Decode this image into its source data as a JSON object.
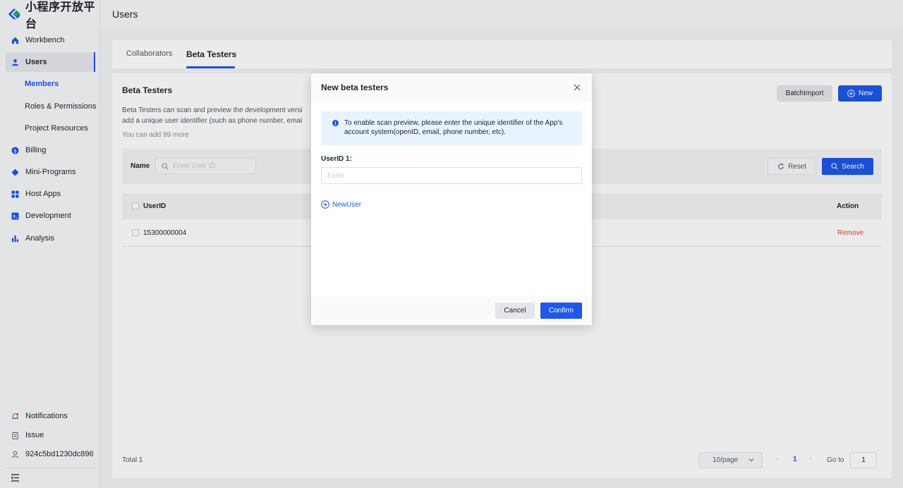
{
  "app": {
    "name": "小程序开放平台",
    "page_title": "Users",
    "brand_color": "#1e57e9",
    "danger_color": "#f53f3f"
  },
  "sidebar": {
    "items": [
      {
        "label": "Workbench",
        "icon": "home-icon"
      },
      {
        "label": "Users",
        "icon": "user-icon",
        "active": true
      },
      {
        "label": "Billing",
        "icon": "billing-icon"
      },
      {
        "label": "Mini-Programs",
        "icon": "mini-programs-icon"
      },
      {
        "label": "Host Apps",
        "icon": "grid-icon"
      },
      {
        "label": "Development",
        "icon": "code-icon"
      },
      {
        "label": "Analysis",
        "icon": "bar-chart-icon"
      }
    ],
    "sub_items": [
      {
        "label": "Members",
        "active": true
      },
      {
        "label": "Roles & Permissions"
      },
      {
        "label": "Project Resources"
      }
    ],
    "bottom": {
      "notifications": "Notifications",
      "issue": "Issue",
      "account": "924c5bd1230dc896"
    }
  },
  "tabs": [
    {
      "label": "Collaborators"
    },
    {
      "label": "Beta Testers",
      "active": true
    }
  ],
  "card": {
    "title": "Beta Testers",
    "desc_line1": "Beta Testers can scan and preview the development versi",
    "desc_line2": "add a unique user identifier (such as phone number, emai",
    "count_text": "You can add 99 more",
    "batch_import": "BatchImport",
    "new_label": "New"
  },
  "filter": {
    "name_label": "Name",
    "search_placeholder": "Enter User ID",
    "reset_label": "Reset",
    "search_label": "Search"
  },
  "table": {
    "columns": {
      "user_id": "UserID",
      "action": "Action"
    },
    "rows": [
      {
        "user_id": "15300000004",
        "action": "Remove"
      }
    ]
  },
  "pagination": {
    "total": "Total 1",
    "page_size": "10/page",
    "prev": "‹",
    "current": "1",
    "next": "›",
    "goto_label": "Go to",
    "goto_value": "1"
  },
  "modal": {
    "title": "New beta testers",
    "info": "To enable scan preview, please enter the unique identifier of the App's account system(openID, email, phone number, etc).",
    "field_label": "UserID 1:",
    "field_placeholder": "Enter",
    "add_user": "NewUser",
    "cancel": "Cancel",
    "confirm": "Confirm"
  }
}
